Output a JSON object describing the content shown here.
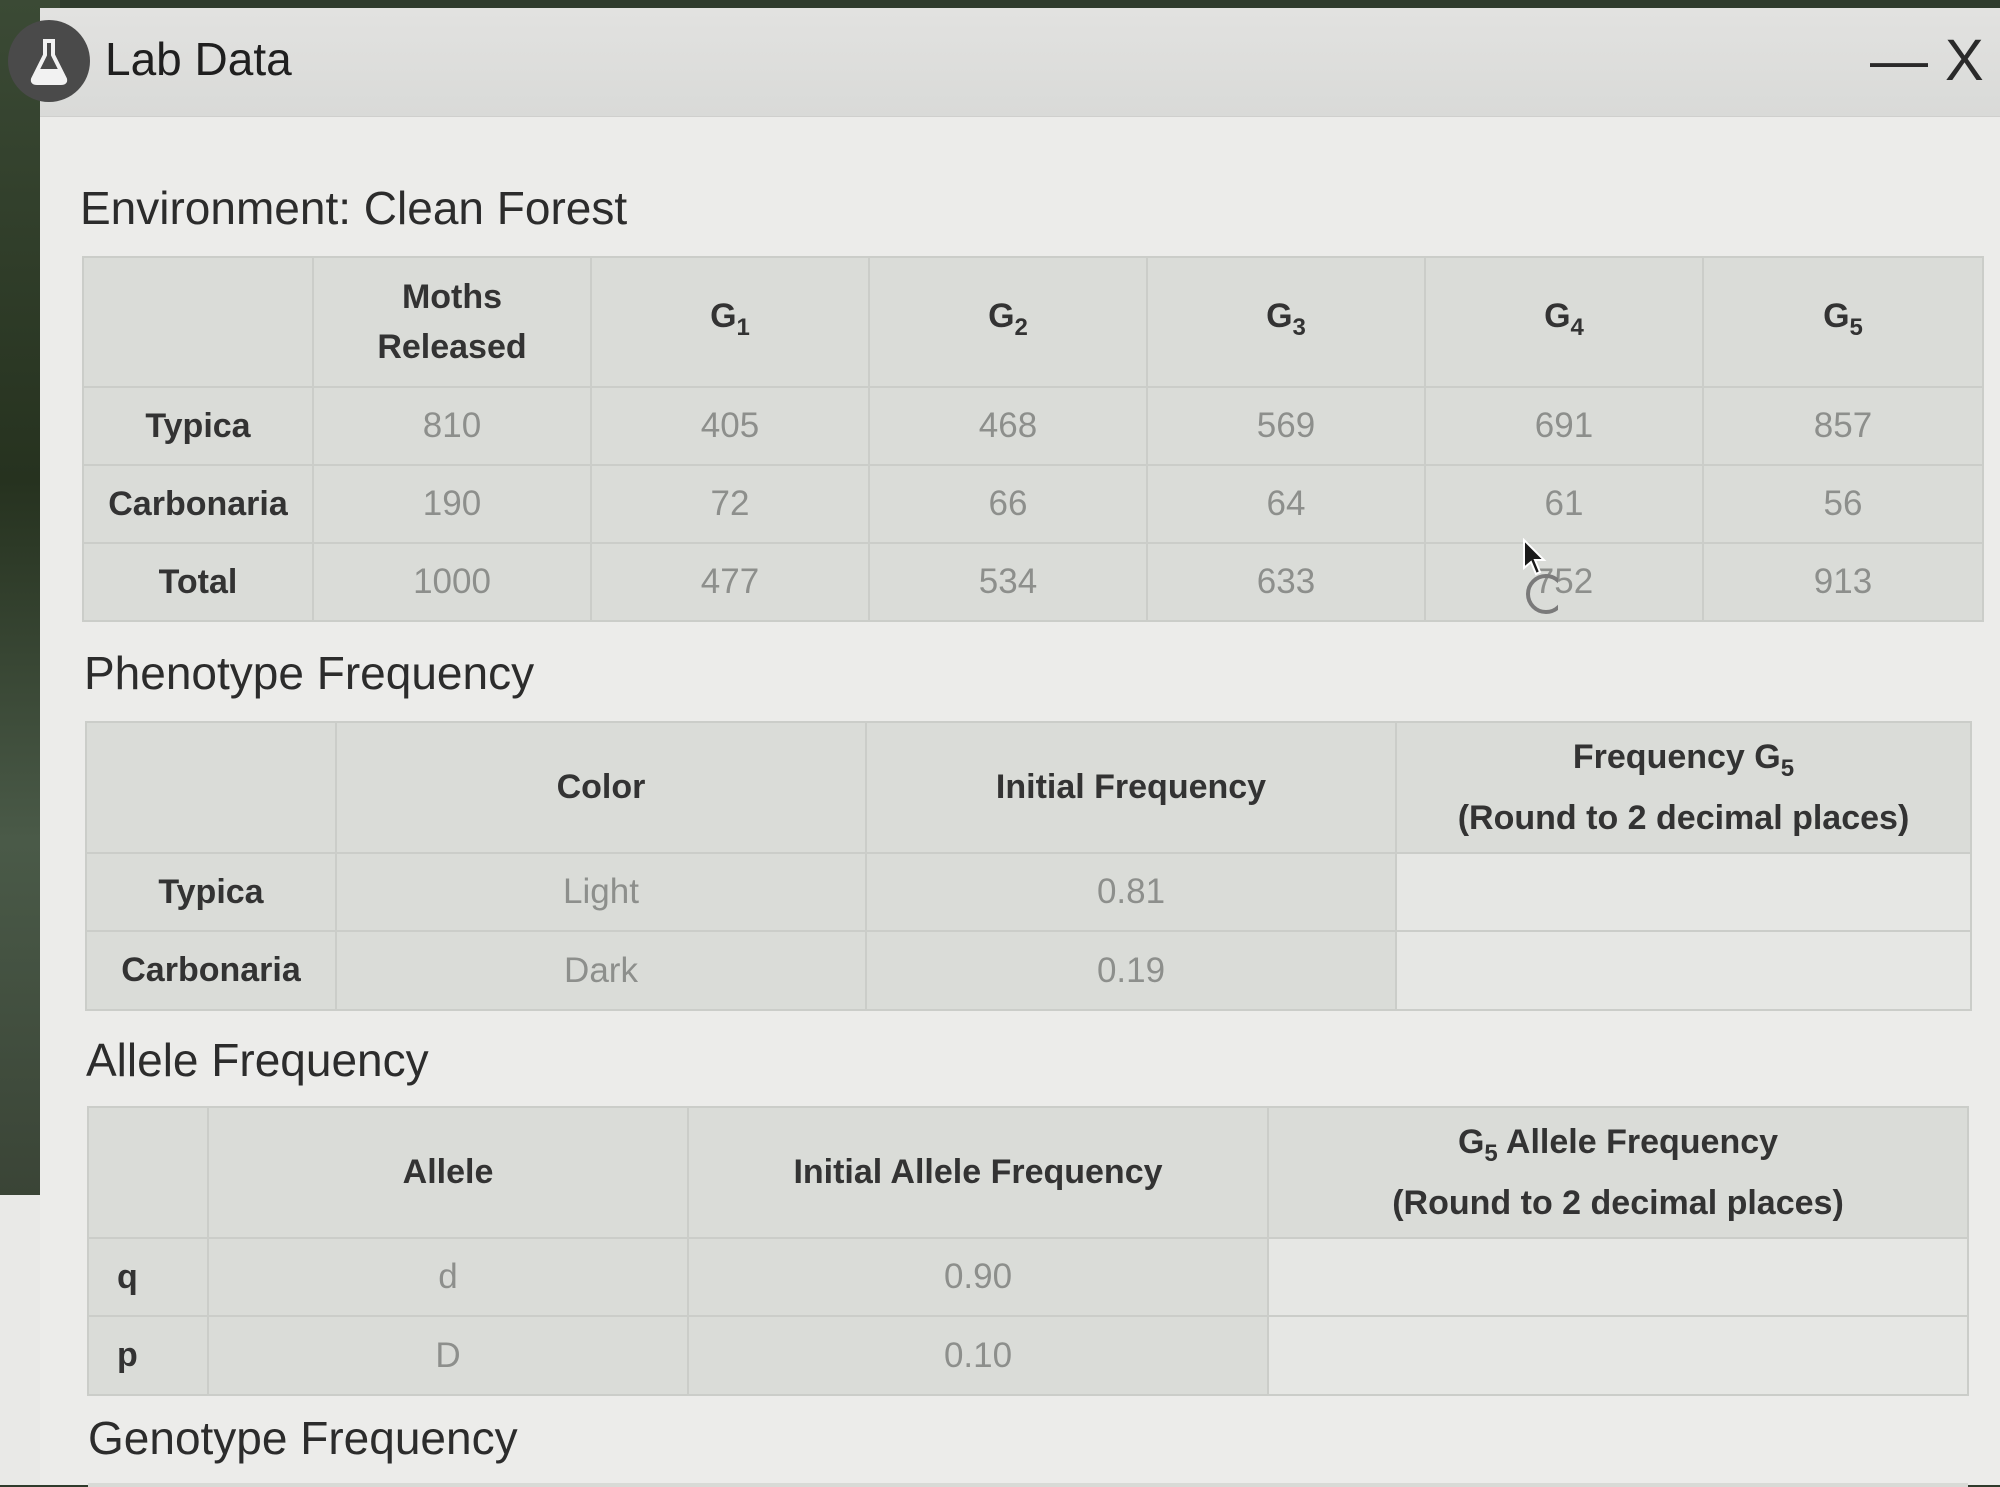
{
  "window": {
    "title": "Lab Data",
    "minimize_label": "—",
    "close_label": "X",
    "icon": "flask-icon"
  },
  "environment": {
    "label": "Environment: Clean Forest"
  },
  "moths_table": {
    "headers": {
      "blank": "",
      "released_line1": "Moths",
      "released_line2": "Released",
      "g1": "G",
      "g2": "G",
      "g3": "G",
      "g4": "G",
      "g5": "G",
      "g1_sub": "1",
      "g2_sub": "2",
      "g3_sub": "3",
      "g4_sub": "4",
      "g5_sub": "5"
    },
    "rows": [
      {
        "label": "Typica",
        "values": [
          "810",
          "405",
          "468",
          "569",
          "691",
          "857"
        ]
      },
      {
        "label": "Carbonaria",
        "values": [
          "190",
          "72",
          "66",
          "64",
          "61",
          "56"
        ]
      },
      {
        "label": "Total",
        "values": [
          "1000",
          "477",
          "534",
          "633",
          "752",
          "913"
        ]
      }
    ]
  },
  "phenotype": {
    "title": "Phenotype Frequency",
    "headers": {
      "color": "Color",
      "initial": "Initial Frequency",
      "g5_line1": "Frequency G",
      "g5_sub": "5",
      "g5_line2": "(Round to 2 decimal places)"
    },
    "rows": [
      {
        "label": "Typica",
        "color": "Light",
        "initial": "0.81",
        "g5": ""
      },
      {
        "label": "Carbonaria",
        "color": "Dark",
        "initial": "0.19",
        "g5": ""
      }
    ]
  },
  "allele": {
    "title": "Allele Frequency",
    "headers": {
      "allele": "Allele",
      "initial": "Initial Allele Frequency",
      "g5_pre": "G",
      "g5_sub": "5",
      "g5_line1": " Allele Frequency",
      "g5_line2": "(Round to 2 decimal places)"
    },
    "rows": [
      {
        "label": "q",
        "allele": "d",
        "initial": "0.90",
        "g5": ""
      },
      {
        "label": "p",
        "allele": "D",
        "initial": "0.10",
        "g5": ""
      }
    ]
  },
  "genotype": {
    "title": "Genotype Frequency"
  }
}
